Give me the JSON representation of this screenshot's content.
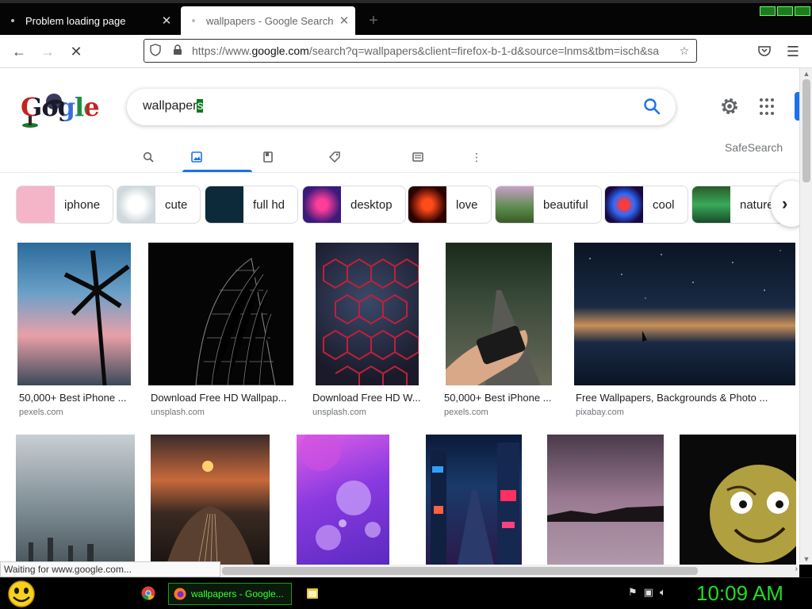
{
  "browser": {
    "tabs": [
      {
        "label": "Problem loading page",
        "active": false
      },
      {
        "label": "wallpapers - Google Search",
        "active": true
      }
    ],
    "new_tab_label": "+",
    "url": {
      "prefix": "https://www.",
      "domain": "google.com",
      "rest": "/search?q=wallpapers&client=firefox-b-1-d&source=lnms&tbm=isch&sa"
    },
    "status_text": "Waiting for www.google.com..."
  },
  "google": {
    "logo_text": "Gogle",
    "query_main": "wallpaper",
    "query_selected": "s",
    "safesearch": "SafeSearch",
    "accent": "#1a73e8"
  },
  "chips": [
    {
      "label": "iphone",
      "color": "#f5b5c8"
    },
    {
      "label": "cute",
      "color": "#dfe6ea"
    },
    {
      "label": "full hd",
      "color": "#0d2a3a"
    },
    {
      "label": "desktop",
      "color": "#5a1a7a"
    },
    {
      "label": "love",
      "color": "#2a0000"
    },
    {
      "label": "beautiful",
      "color": "#5a8a4a"
    },
    {
      "label": "cool",
      "color": "#2a1050"
    },
    {
      "label": "nature",
      "color": "#1e6a3a"
    }
  ],
  "results": [
    {
      "caption": "50,000+ Best iPhone ...",
      "source": "pexels.com"
    },
    {
      "caption": "Download Free HD Wallpap...",
      "source": "unsplash.com"
    },
    {
      "caption": "Download Free HD W...",
      "source": "unsplash.com"
    },
    {
      "caption": "50,000+ Best iPhone ...",
      "source": "pexels.com"
    },
    {
      "caption": "Free Wallpapers, Backgrounds & Photo ...",
      "source": "pixabay.com"
    }
  ],
  "taskbar": {
    "firefox_label": "wallpapers - Google...",
    "clock": "10:09 AM"
  }
}
